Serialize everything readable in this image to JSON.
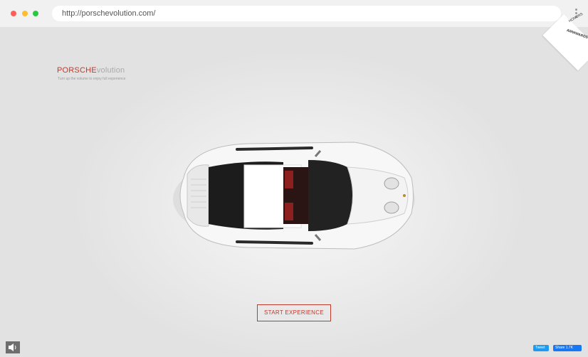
{
  "browser": {
    "url": "http://porschevolution.com/"
  },
  "header": {
    "brand_primary": "PORSCHE",
    "brand_secondary": "volution",
    "tagline": "Turn up the volume to enjoy full experience"
  },
  "ribbon": {
    "line1": "HONORS",
    "line2": "AWWWARDS"
  },
  "main": {
    "start_label": "START EXPERIENCE"
  },
  "share": {
    "tweet_label": "Tweet",
    "facebook_label": "Share 1.7K"
  },
  "icons": {
    "sound": "speaker-icon"
  },
  "colors": {
    "accent": "#c0392b",
    "tweet": "#1d9bf0",
    "facebook": "#1877f2"
  }
}
